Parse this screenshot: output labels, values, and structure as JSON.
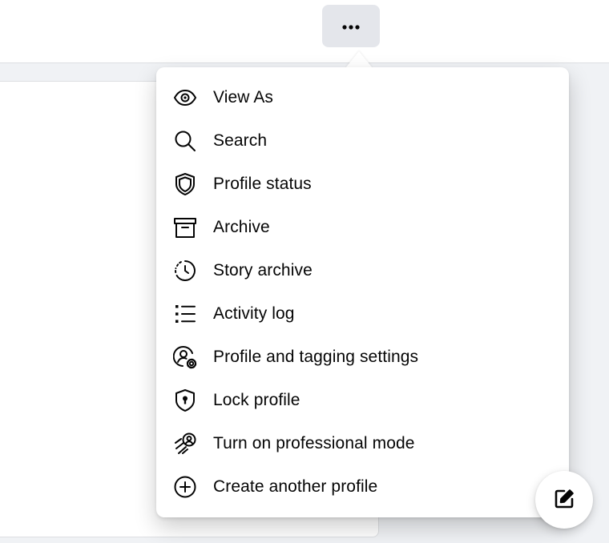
{
  "toolbar": {
    "more_button_icon": "more-horizontal-icon"
  },
  "menu": {
    "items": [
      {
        "label": "View As",
        "icon": "eye-icon"
      },
      {
        "label": "Search",
        "icon": "search-icon"
      },
      {
        "label": "Profile status",
        "icon": "shield-icon"
      },
      {
        "label": "Archive",
        "icon": "archive-box-icon"
      },
      {
        "label": "Story archive",
        "icon": "story-clock-icon"
      },
      {
        "label": "Activity log",
        "icon": "list-icon"
      },
      {
        "label": "Profile and tagging settings",
        "icon": "user-gear-icon"
      },
      {
        "label": "Lock profile",
        "icon": "lock-shield-icon"
      },
      {
        "label": "Turn on professional mode",
        "icon": "professional-mode-icon"
      },
      {
        "label": "Create another profile",
        "icon": "plus-circle-icon"
      }
    ]
  },
  "fab": {
    "icon": "compose-icon"
  },
  "colors": {
    "background": "#f0f2f5",
    "menu_text": "#050505",
    "icon": "#050505",
    "button_bg": "#e4e6eb"
  }
}
